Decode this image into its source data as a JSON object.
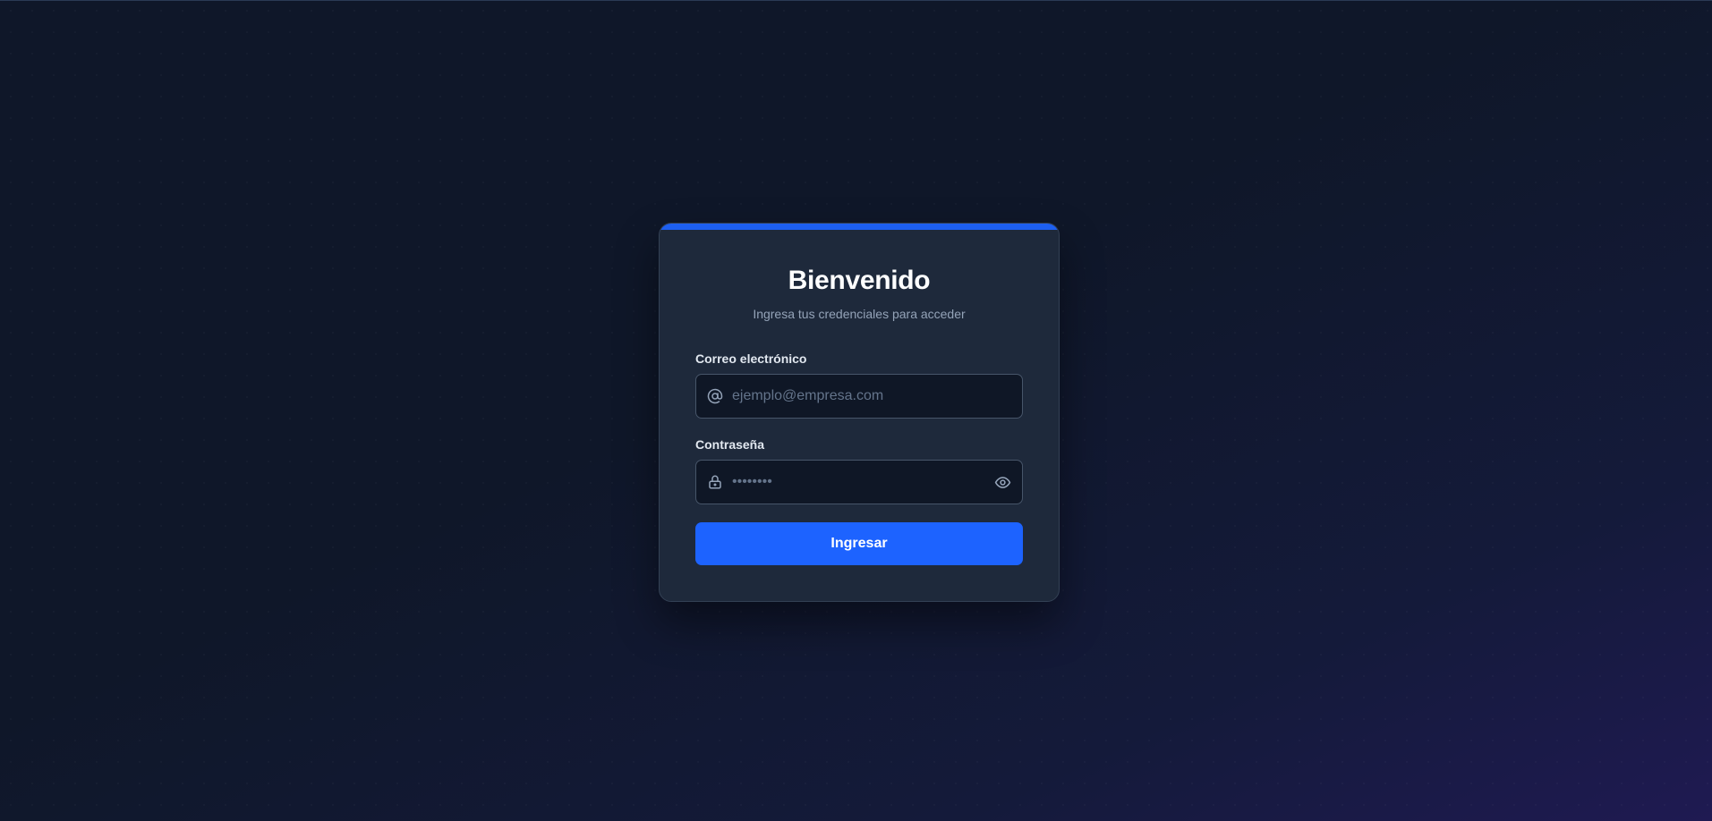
{
  "login": {
    "title": "Bienvenido",
    "subtitle": "Ingresa tus credenciales para acceder",
    "email": {
      "label": "Correo electrónico",
      "placeholder": "ejemplo@empresa.com",
      "value": "",
      "icon": "at-sign-icon"
    },
    "password": {
      "label": "Contraseña",
      "placeholder": "••••••••",
      "value": "",
      "icon": "lock-icon",
      "toggle_icon": "eye-icon"
    },
    "submit_label": "Ingresar"
  },
  "colors": {
    "accent": "#1d63ff",
    "card_background": "#1e293b",
    "page_background": "#0f1729"
  }
}
